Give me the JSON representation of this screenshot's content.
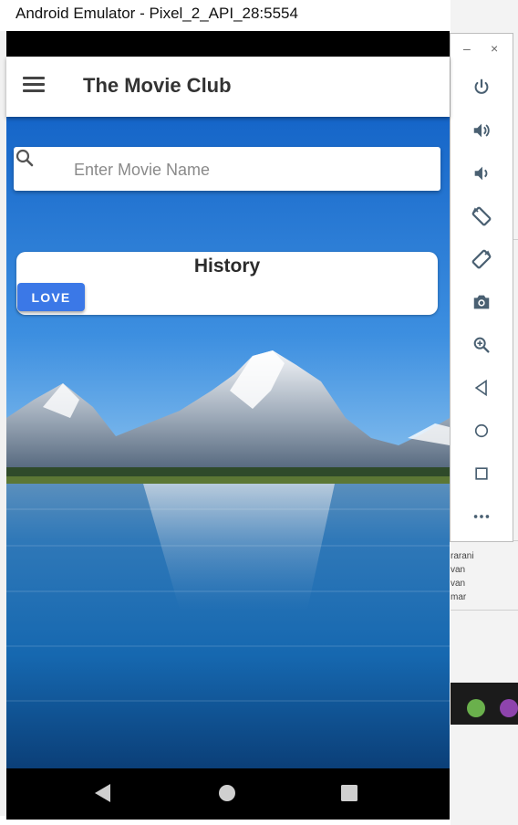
{
  "window": {
    "title": "Android Emulator - Pixel_2_API_28:5554",
    "minimize": "–",
    "close": "×"
  },
  "app": {
    "title": "The Movie Club",
    "search": {
      "placeholder": "Enter Movie Name",
      "value": ""
    },
    "card": {
      "title": "History",
      "button_label": "LOVE"
    }
  },
  "toolbar_icons": [
    "power-icon",
    "volume-up-icon",
    "volume-down-icon",
    "rotate-left-icon",
    "rotate-right-icon",
    "camera-icon",
    "zoom-icon",
    "back-icon",
    "home-icon",
    "overview-icon",
    "more-icon"
  ],
  "background_desktop_text": [
    "rarani",
    "van",
    "van",
    "mar"
  ],
  "colors": {
    "accent": "#3b78e7",
    "sky_top": "#1565c8",
    "lake": "#1668b0"
  }
}
